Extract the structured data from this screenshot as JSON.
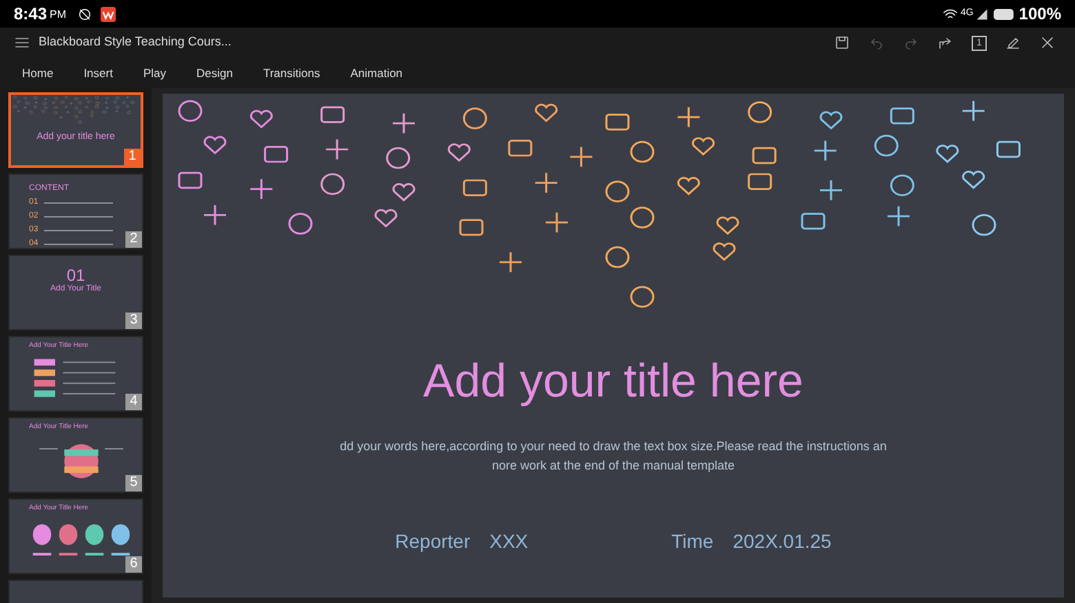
{
  "status_bar": {
    "time": "8:43",
    "ampm": "PM",
    "network": "4G",
    "battery": "100%"
  },
  "title_bar": {
    "title": "Blackboard Style Teaching Cours...",
    "slide_indicator": "1"
  },
  "menu": [
    {
      "label": "Home",
      "selected": false
    },
    {
      "label": "Insert",
      "selected": false
    },
    {
      "label": "Play",
      "selected": false
    },
    {
      "label": "Design",
      "selected": false
    },
    {
      "label": "Transitions",
      "selected": false
    },
    {
      "label": "Animation",
      "selected": false
    }
  ],
  "slides": [
    {
      "number": "1",
      "selected": true,
      "kind": "title",
      "texts": [
        "Add your title here"
      ]
    },
    {
      "number": "2",
      "selected": false,
      "kind": "contents",
      "texts": [
        "CONTENT",
        "01",
        "02",
        "03",
        "04"
      ]
    },
    {
      "number": "3",
      "selected": false,
      "kind": "section",
      "texts": [
        "01",
        "Add Your Title"
      ]
    },
    {
      "number": "4",
      "selected": false,
      "kind": "ribbons",
      "texts": [
        "Add Your Title Here"
      ]
    },
    {
      "number": "5",
      "selected": false,
      "kind": "globe",
      "texts": [
        "Add Your Title Here"
      ]
    },
    {
      "number": "6",
      "selected": false,
      "kind": "shapes",
      "texts": [
        "Add Your Title Here"
      ]
    },
    {
      "selected": false,
      "kind": "cut"
    }
  ],
  "slide": {
    "title": "Add your title here",
    "body": [
      "dd your words here,according to your need to draw the text box size.Please read the instructions an",
      "nore work at the end of the manual template"
    ],
    "reporter_label": "Reporter",
    "reporter": "XXX",
    "time_label": "Time",
    "time": "202X.01.25"
  }
}
